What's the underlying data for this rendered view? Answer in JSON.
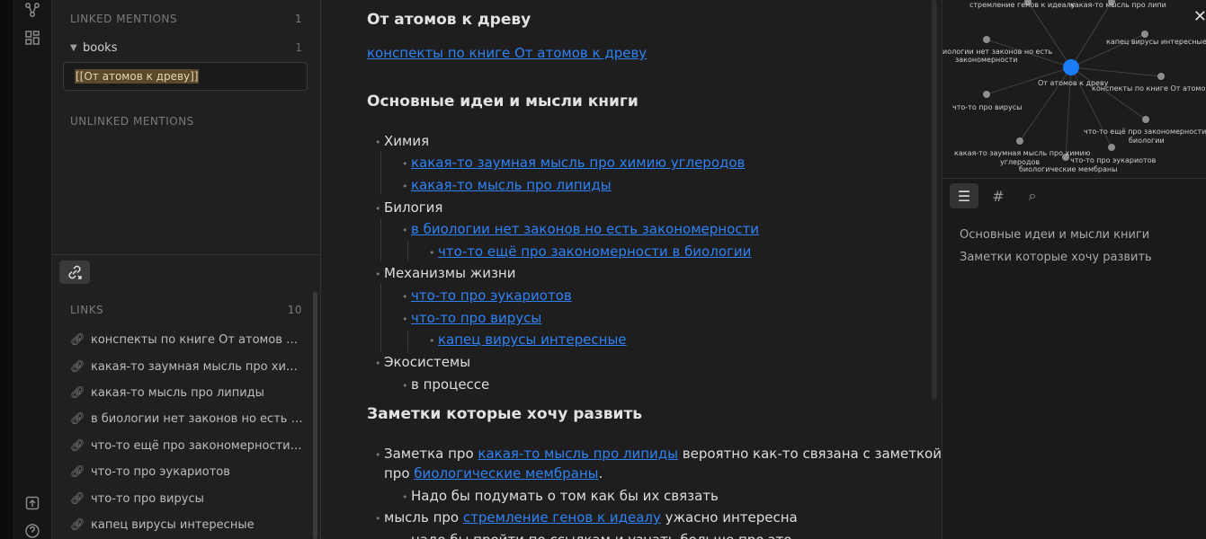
{
  "left_panel": {
    "linked_mentions": {
      "label": "LINKED MENTIONS",
      "count": "1"
    },
    "group": {
      "name": "books",
      "count": "1"
    },
    "mention_text": "[[От атомов к древу]]",
    "unlinked_mentions": {
      "label": "UNLINKED MENTIONS"
    },
    "links_header": {
      "label": "LINKS",
      "count": "10"
    },
    "links": [
      "конспекты по книге От атомов к ...",
      "какая-то заумная мысль про хим...",
      "какая-то мысль про липиды",
      "в биологии нет законов но есть з...",
      "что-то ещё про закономерности ...",
      "что-то про эукариотов",
      "что-то про вирусы",
      "капец вирусы интересные"
    ]
  },
  "editor": {
    "title": "От атомов к древу",
    "top_link": "конспекты по книге От атомов к древу",
    "section1": "Основные идеи и мысли книги",
    "tree": {
      "chem": "Химия",
      "chem_1": "какая-то заумная мысль про химию углеродов",
      "chem_2": "какая-то мысль про липиды",
      "bio": "Билогия",
      "bio_1": "в биологии нет законов но есть закономерности",
      "bio_1_1": "что-то ещё про закономерности в биологии",
      "mech": "Механизмы жизни",
      "mech_1": "что-то про эукариотов",
      "mech_2": "что-то про вирусы",
      "mech_2_1": "капец вирусы интересные",
      "eco": "Экосистемы",
      "eco_1": "в процессе"
    },
    "section2": "Заметки которые хочу развить",
    "notes": {
      "n1_pre": "Заметка про ",
      "n1_link": "какая-то мысль про липиды",
      "n1_post": " вероятно как-то связана с заметкой",
      "n1_line2_pre": "про ",
      "n1_line2_link": "биологические мембраны",
      "n1_line2_post": ".",
      "n1_sub": "Надо бы подумать о том как бы их связать",
      "n2_pre": "мысль про ",
      "n2_link": "стремление генов к идеалу",
      "n2_post": " ужасно интересна",
      "n2_sub": "надо бы пройти по ссылкам и узнать больше про это"
    }
  },
  "graph": {
    "center_label": "От атомов к древу",
    "nodes": [
      "стремление генов к идеалу",
      "какая-то мысль про липи",
      "капец вирусы интересные",
      "иологии нет законов но есть",
      "закономерности",
      "конспекты по книге От атомов к",
      "что-то про вирусы",
      "что-то ещё про закономерности в",
      "биологии",
      "какая-то заумная мысль про химию",
      "углеродов",
      "что-то про эукариотов",
      "биологические мембраны"
    ]
  },
  "outline": {
    "items": [
      "Основные идеи и мысли книги",
      "Заметки которые хочу развить"
    ]
  },
  "colors": {
    "accent": "#2f82f5",
    "node_center": "#1a7bf6"
  }
}
